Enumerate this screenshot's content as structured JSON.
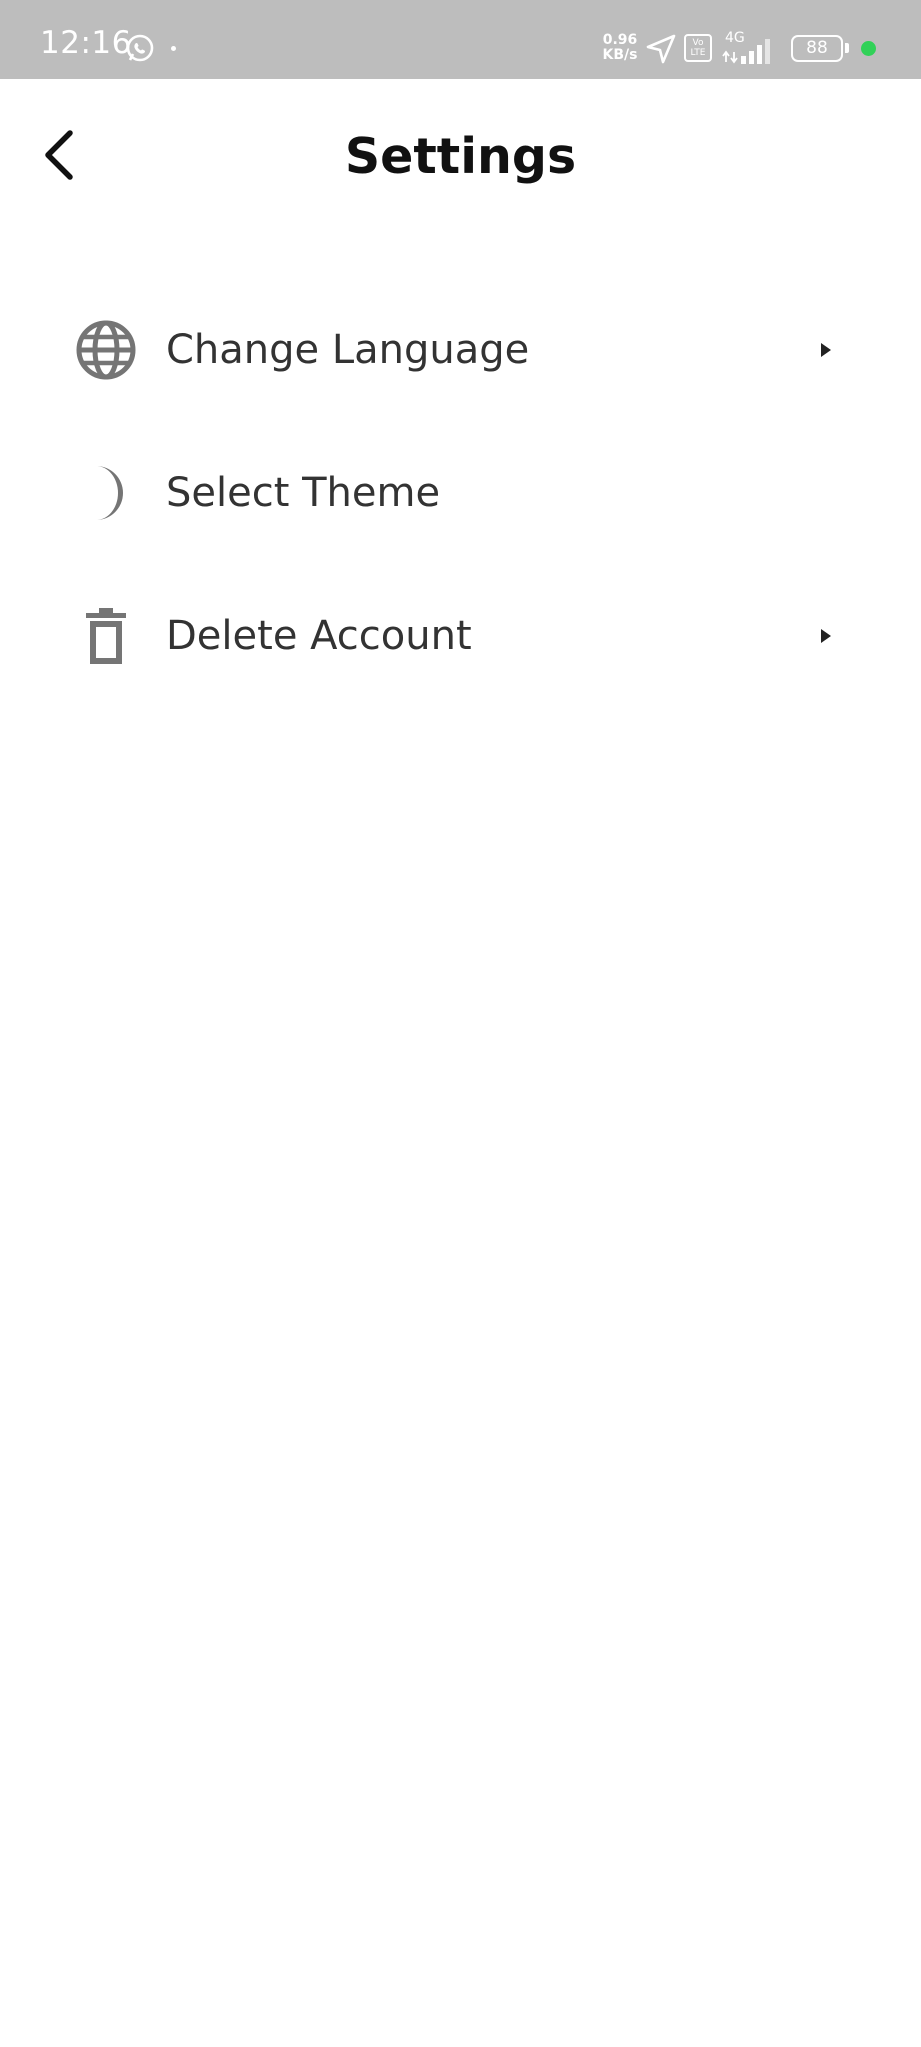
{
  "status_bar": {
    "time": "12:16",
    "net_speed_value": "0.96",
    "net_speed_unit": "KB/s",
    "volte_top": "Vo",
    "volte_bottom": "LTE",
    "network": "4G",
    "battery": "88",
    "icons": [
      "whatsapp-icon",
      "navigation-icon",
      "volte-icon",
      "signal-icon",
      "battery-icon"
    ],
    "indicator_color": "#31d158"
  },
  "header": {
    "title": "Settings",
    "back_icon": "back-arrow-icon"
  },
  "menu": {
    "items": [
      {
        "label": "Change Language",
        "icon": "globe-icon",
        "has_arrow": true
      },
      {
        "label": "Select Theme",
        "icon": "moon-icon",
        "has_arrow": false
      },
      {
        "label": "Delete Account",
        "icon": "trash-icon",
        "has_arrow": true
      }
    ]
  },
  "colors": {
    "status_bar_bg": "#bdbdbd",
    "icon_gray": "#757575",
    "label_text": "#333333",
    "title_text": "#111111"
  }
}
